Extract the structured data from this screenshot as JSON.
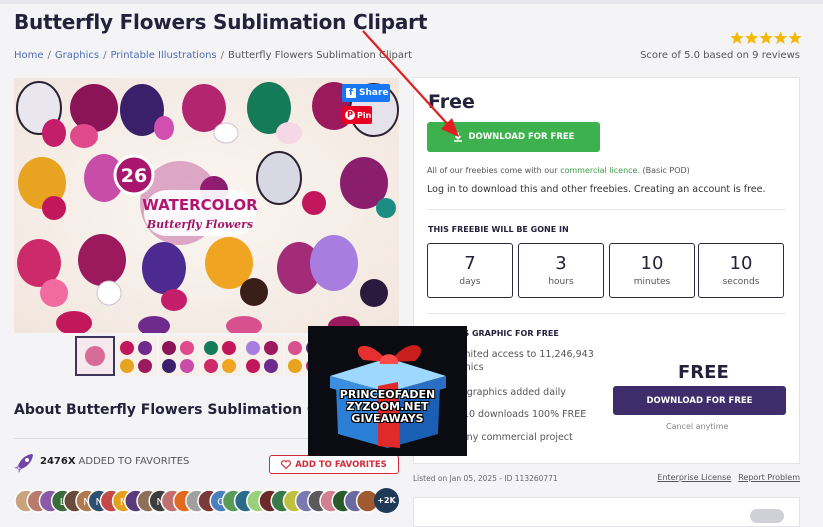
{
  "page": {
    "title": "Butterfly Flowers Sublimation Clipart",
    "breadcrumb": [
      "Home",
      "Graphics",
      "Printable Illustrations",
      "Butterfly Flowers Sublimation Clipart"
    ],
    "rating": {
      "stars": 5,
      "text": "Score of 5.0 based on 9 reviews"
    }
  },
  "preview": {
    "badge_number": "26",
    "badge_title": "WATERCOLOR",
    "badge_subtitle": "Butterfly Flowers",
    "share_label": "Share",
    "pin_label": "Pin",
    "thumbnail_count": 8,
    "selected_thumbnail": 1
  },
  "about": {
    "heading": "About Butterfly Flowers Sublimation Clipart",
    "favorites_count": "2476X",
    "favorites_label": "ADDED TO FAVORITES",
    "add_favorites_label": "ADD TO FAVORITES",
    "avatars": [
      "L",
      "N",
      "N",
      "N",
      "N",
      "O"
    ],
    "more_avatars": "+2K"
  },
  "purchase": {
    "price": "Free",
    "download_label": "DOWNLOAD FOR FREE",
    "note_prefix": "All of our freebies come with our",
    "note_link": "commercial licence.",
    "note_suffix": "(Basic POD)",
    "login_note": "Log in to download this and other freebies. Creating an account is free.",
    "countdown_title": "THIS FREEBIE WILL BE GONE IN",
    "countdown": [
      {
        "value": "7",
        "unit": "days"
      },
      {
        "value": "3",
        "unit": "hours"
      },
      {
        "value": "10",
        "unit": "minutes"
      },
      {
        "value": "10",
        "unit": "seconds"
      }
    ],
    "plus_section_title": "GET THIS GRAPHIC FOR FREE",
    "plus_features": [
      "Unlimited access to 11,246,943 graphics",
      "New graphics added daily",
      "Get 10 downloads 100% FREE",
      "For any commercial project"
    ],
    "plus_price": "FREE",
    "plus_download_label": "DOWNLOAD FOR FREE",
    "cancel_text": "Cancel anytime"
  },
  "footer": {
    "listed_on": "Listed on Jan 05, 2025 - ID 113260771",
    "enterprise_license": "Enterprise License",
    "report_problem": "Report Problem"
  },
  "overlay": {
    "giveaway_text": "PRINCEOFADEN ZYZOOM.NET GIVEAWAYS"
  },
  "colors": {
    "download_green": "#3db14d",
    "plus_purple": "#3f2d6b",
    "favorites_red": "#d22a3c",
    "arrow_red": "#e02020",
    "star_gold": "#f5b800"
  },
  "icons": [
    "star-icon",
    "facebook-icon",
    "pinterest-icon",
    "download-icon",
    "rocket-icon",
    "heart-icon",
    "check-icon",
    "gift-icon",
    "arrow-annotation"
  ]
}
